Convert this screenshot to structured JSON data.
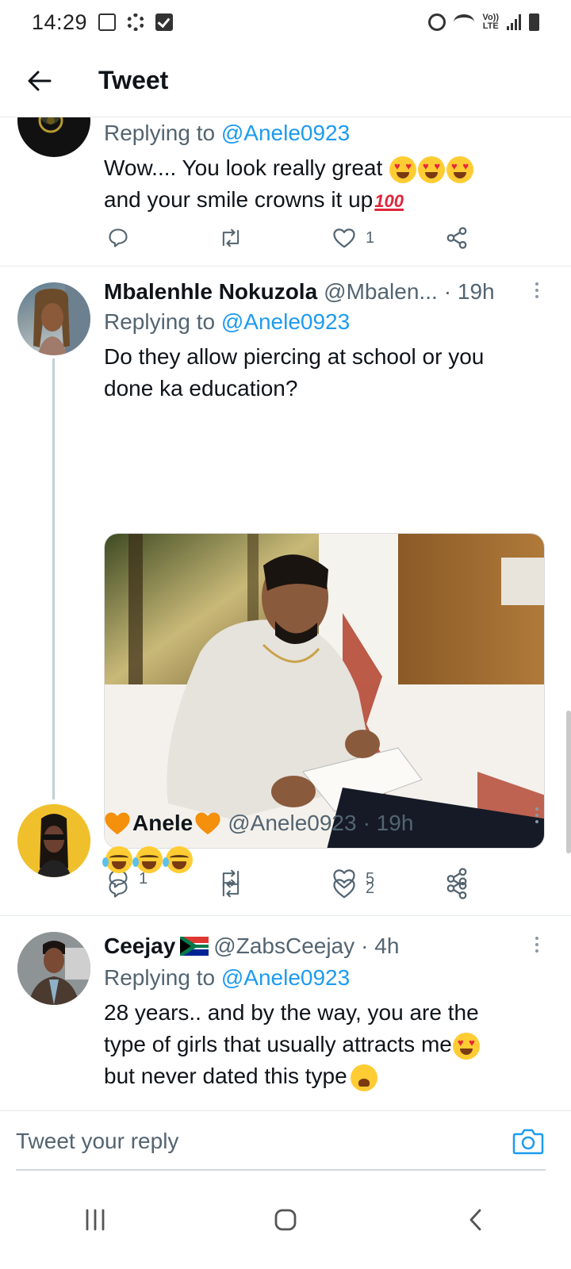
{
  "status_bar": {
    "time": "14:29",
    "icons_left": [
      "image-icon",
      "gear-icon",
      "check-icon"
    ],
    "icons_right": [
      "alarm-icon",
      "wifi-icon",
      "volte-lte-icon",
      "signal-icon",
      "battery-icon"
    ],
    "lte_label_top": "Vo))",
    "lte_label_bottom": "LTE"
  },
  "header": {
    "title": "Tweet"
  },
  "tweets": [
    {
      "replying_prefix": "Replying to",
      "replying_to": "@Anele0923",
      "text_line1": "Wow.... You look really great",
      "text_line2": "and your smile crowns it up",
      "emoji_100": "100",
      "reply_count": "",
      "like_count": "1"
    },
    {
      "name": "Mbalenhle Nokuzola",
      "handle": "@Mbalen...",
      "time": "· 19h",
      "replying_prefix": "Replying to",
      "replying_to": "@Anele0923",
      "text": "Do they allow piercing at school or you done ka education?",
      "reply_count": "1",
      "like_count": "5"
    },
    {
      "name": "Anele",
      "handle": "@Anele0923",
      "time": "· 19h",
      "reply_count": "",
      "like_count": "2"
    },
    {
      "name": "Ceejay",
      "handle": "@ZabsCeejay",
      "time": "· 4h",
      "replying_prefix": "Replying to",
      "replying_to": "@Anele0923",
      "text_line1": "28 years.. and  by the way, you are the",
      "text_line2": "type of girls that usually attracts me",
      "text_line3": "but never dated this type"
    }
  ],
  "reply_bar": {
    "placeholder": "Tweet your reply"
  },
  "colors": {
    "accent": "#1d9bf0",
    "secondary_text": "#536471",
    "divider": "#e6e9ea",
    "orange_heart": "#f4900c"
  }
}
